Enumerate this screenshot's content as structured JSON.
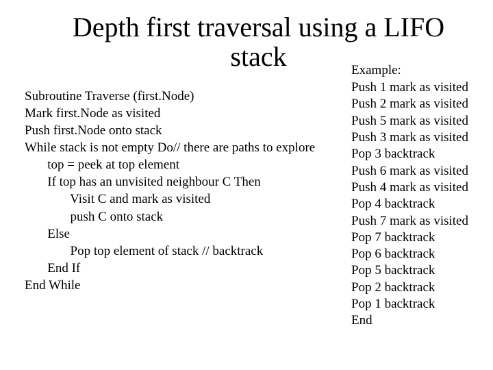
{
  "title": "Depth first traversal using a LIFO\nstack",
  "pseudocode": [
    {
      "indent": 0,
      "text": "Subroutine Traverse (first.Node)"
    },
    {
      "indent": 0,
      "text": "Mark first.Node as visited"
    },
    {
      "indent": 0,
      "text": "Push first.Node onto stack"
    },
    {
      "indent": 0,
      "text": "While stack is not empty Do// there are paths to explore"
    },
    {
      "indent": 1,
      "text": "top = peek at top element"
    },
    {
      "indent": 1,
      "text": "If top has an unvisited neighbour C Then"
    },
    {
      "indent": 2,
      "text": "Visit C and mark as visited"
    },
    {
      "indent": 2,
      "text": "push C onto stack"
    },
    {
      "indent": 1,
      "text": "Else"
    },
    {
      "indent": 2,
      "text": "Pop top element of stack // backtrack"
    },
    {
      "indent": 1,
      "text": "End If"
    },
    {
      "indent": 0,
      "text": "End While"
    }
  ],
  "example_label": "Example:",
  "example_lines": [
    "Push 1 mark as visited",
    "Push 2 mark as visited",
    "Push 5 mark as visited",
    "Push 3 mark as visited",
    "Pop 3 backtrack",
    "Push 6 mark as visited",
    "Push 4 mark as visited",
    "Pop 4 backtrack",
    "Push 7 mark as visited",
    "Pop 7 backtrack",
    "Pop 6 backtrack",
    "Pop 5 backtrack",
    "Pop 2 backtrack",
    "Pop 1 backtrack",
    "End"
  ]
}
